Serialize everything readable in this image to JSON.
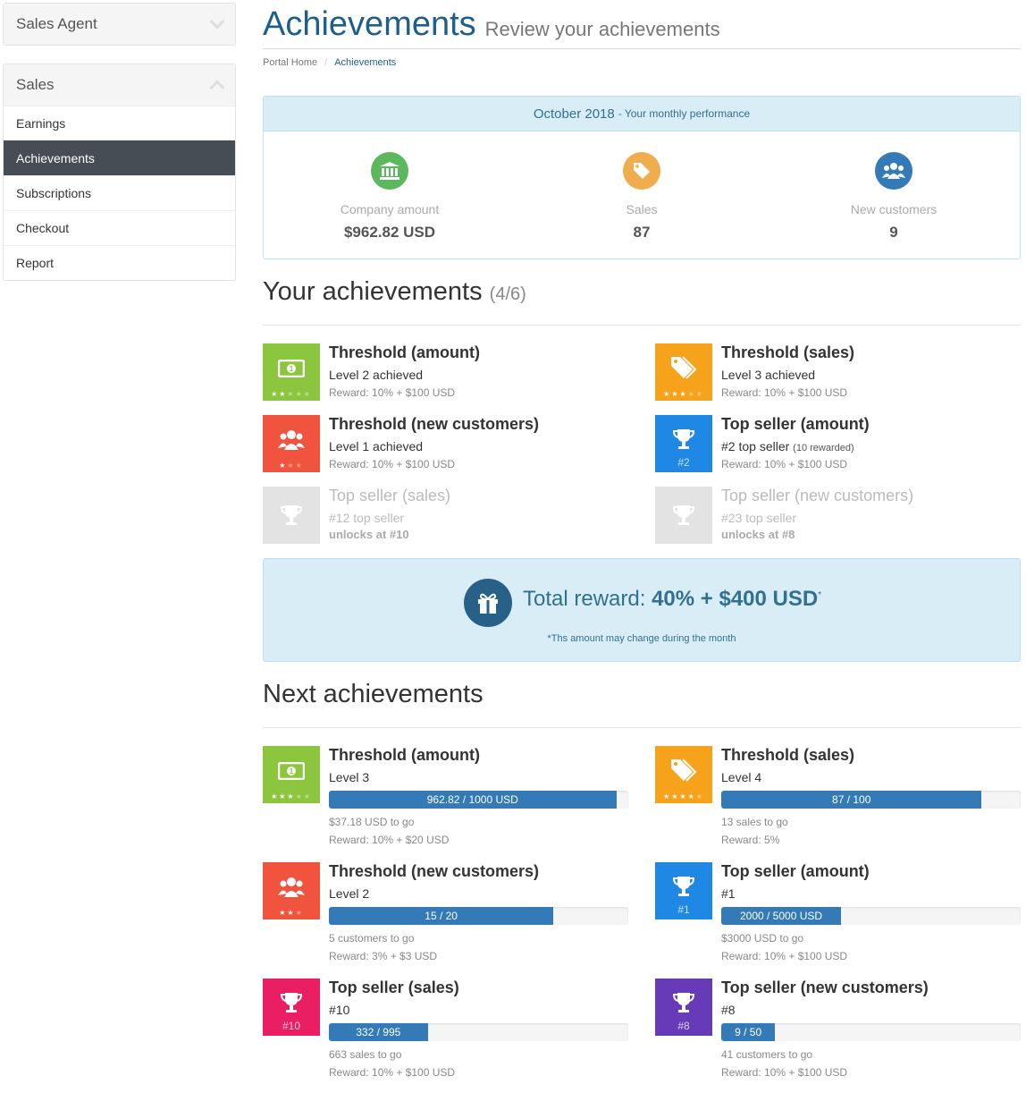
{
  "sidebar": {
    "agent_panel": {
      "title": "Sales Agent"
    },
    "sales_panel": {
      "title": "Sales",
      "items": [
        {
          "label": "Earnings"
        },
        {
          "label": "Achievements"
        },
        {
          "label": "Subscriptions"
        },
        {
          "label": "Checkout"
        },
        {
          "label": "Report"
        }
      ]
    }
  },
  "header": {
    "title": "Achievements",
    "subtitle": "Review your achievements"
  },
  "breadcrumb": {
    "home": "Portal Home",
    "separator": "/",
    "current": "Achievements"
  },
  "performance": {
    "month": "October 2018",
    "subtitle": "- Your monthly performance",
    "stats": [
      {
        "icon": "bank-icon",
        "label": "Company amount",
        "value": "$962.82 USD",
        "color": "#5cb85c"
      },
      {
        "icon": "tags-icon",
        "label": "Sales",
        "value": "87",
        "color": "#f0ad4e"
      },
      {
        "icon": "users-icon",
        "label": "New customers",
        "value": "9",
        "color": "#337ab7"
      }
    ]
  },
  "your_achievements": {
    "title": "Your achievements",
    "count": "(4/6)",
    "items": [
      {
        "icon": "money-icon",
        "color": "#8cc63f",
        "stars": 2,
        "title": "Threshold (amount)",
        "line1": "Level 2 achieved",
        "line2": "Reward: 10% + $100 USD"
      },
      {
        "icon": "tags-icon",
        "color": "#f7a21b",
        "stars": 3,
        "title": "Threshold (sales)",
        "line1": "Level 3 achieved",
        "line2": "Reward: 10% + $100 USD"
      },
      {
        "icon": "users-icon",
        "color": "#f0533e",
        "stars": 1,
        "title": "Threshold (new customers)",
        "line1": "Level 1 achieved",
        "line2": "Reward: 10% + $100 USD"
      },
      {
        "icon": "trophy-icon",
        "color": "#1f88e5",
        "rank": "#2",
        "title": "Top seller (amount)",
        "line1": "#2 top seller",
        "line1_note": "(10 rewarded)",
        "line2": "Reward: 10% + $100 USD"
      },
      {
        "icon": "trophy-icon",
        "color": "#e0e0e0",
        "locked": true,
        "title": "Top seller (sales)",
        "line1": "#12 top seller",
        "line2": "unlocks at #10"
      },
      {
        "icon": "trophy-icon",
        "color": "#e0e0e0",
        "locked": true,
        "title": "Top seller (new customers)",
        "line1": "#23 top seller",
        "line2": "unlocks at #8"
      }
    ]
  },
  "reward": {
    "label": "Total reward:",
    "percent": "40%",
    "plus": "+",
    "amount": "$400 USD",
    "mark": "*",
    "note": "*Ths amount may change during the month"
  },
  "next_achievements": {
    "title": "Next achievements",
    "items": [
      {
        "icon": "money-icon",
        "color": "#8cc63f",
        "stars": 3,
        "title": "Threshold (amount)",
        "level": "Level 3",
        "progress_text": "962.82 / 1000 USD",
        "progress": 0.96,
        "to_go": "$37.18 USD to go",
        "reward": "Reward: 10% + $20 USD"
      },
      {
        "icon": "tags-icon",
        "color": "#f7a21b",
        "stars": 4,
        "title": "Threshold (sales)",
        "level": "Level 4",
        "progress_text": "87 / 100",
        "progress": 0.87,
        "to_go": "13 sales to go",
        "reward": "Reward: 5%"
      },
      {
        "icon": "users-icon",
        "color": "#f0533e",
        "stars": 2,
        "title": "Threshold (new customers)",
        "level": "Level 2",
        "progress_text": "15 / 20",
        "progress": 0.75,
        "to_go": "5 customers to go",
        "reward": "Reward: 3% + $3 USD"
      },
      {
        "icon": "trophy-icon",
        "color": "#1f88e5",
        "rank": "#1",
        "title": "Top seller (amount)",
        "level": "#1",
        "progress_text": "2000 / 5000 USD",
        "progress": 0.4,
        "to_go": "$3000 USD to go",
        "reward": "Reward: 10% + $100 USD"
      },
      {
        "icon": "trophy-icon",
        "color": "#e91e63",
        "rank": "#10",
        "title": "Top seller (sales)",
        "level": "#10",
        "progress_text": "332 / 995",
        "progress": 0.33,
        "to_go": "663 sales to go",
        "reward": "Reward: 10% + $100 USD"
      },
      {
        "icon": "trophy-icon",
        "color": "#673ab7",
        "rank": "#8",
        "title": "Top seller (new customers)",
        "level": "#8",
        "progress_text": "9 / 50",
        "progress": 0.18,
        "to_go": "41 customers to go",
        "reward": "Reward: 10% + $100 USD"
      }
    ]
  }
}
